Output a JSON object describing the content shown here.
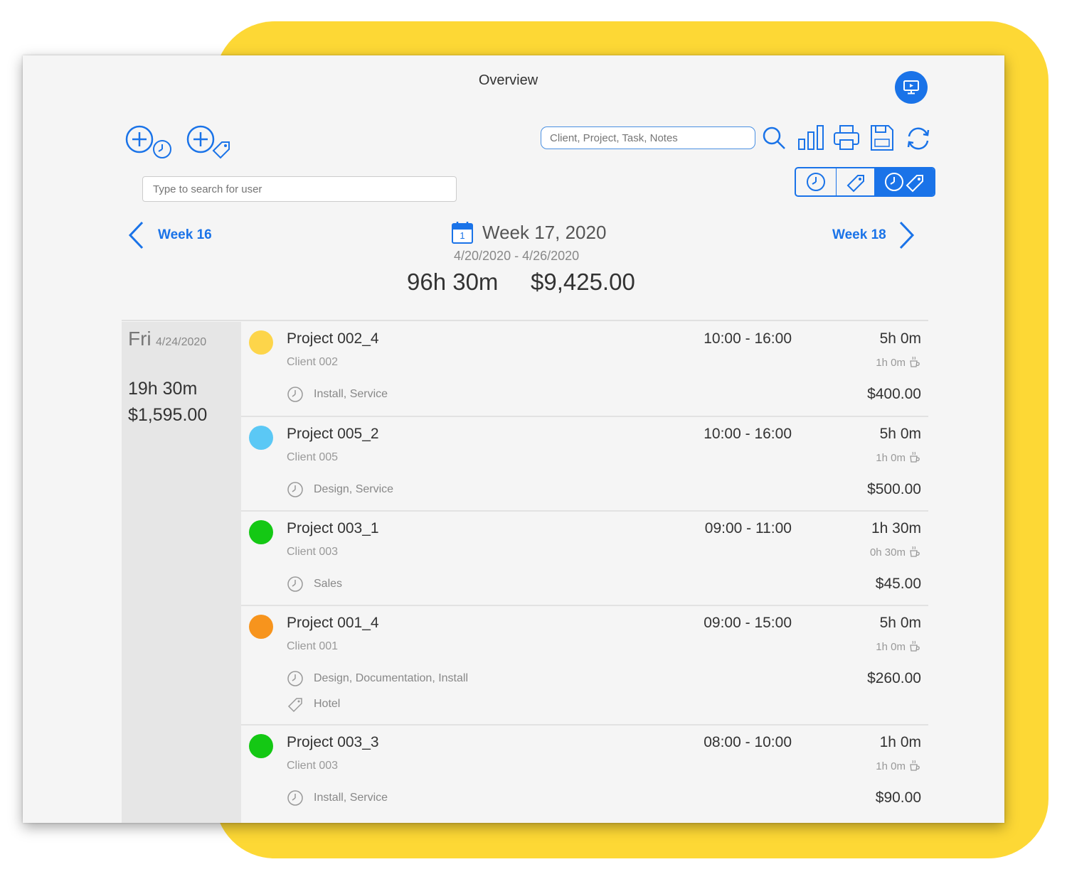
{
  "app": {
    "title": "Overview"
  },
  "toolbar": {
    "search_placeholder": "Client, Project, Task, Notes",
    "user_search_placeholder": "Type to search for user"
  },
  "week_nav": {
    "prev_label": "Week 16",
    "next_label": "Week 18",
    "current_title": "Week 17, 2020",
    "calendar_day": "1",
    "date_range": "4/20/2020 - 4/26/2020",
    "total_hours": "96h 30m",
    "total_amount": "$9,425.00"
  },
  "day": {
    "name": "Fri",
    "date": "4/24/2020",
    "hours": "19h 30m",
    "amount": "$1,595.00"
  },
  "entries": [
    {
      "project": "Project 002_4",
      "client": "Client 002",
      "time": "10:00 - 16:00",
      "duration": "5h 0m",
      "break": "1h 0m",
      "tasks": "Install, Service",
      "expense": "",
      "amount": "$400.00",
      "color": "#FDD54A"
    },
    {
      "project": "Project 005_2",
      "client": "Client 005",
      "time": "10:00 - 16:00",
      "duration": "5h 0m",
      "break": "1h 0m",
      "tasks": "Design, Service",
      "expense": "",
      "amount": "$500.00",
      "color": "#5BC8F5"
    },
    {
      "project": "Project 003_1",
      "client": "Client 003",
      "time": "09:00 - 11:00",
      "duration": "1h 30m",
      "break": "0h 30m",
      "tasks": "Sales",
      "expense": "",
      "amount": "$45.00",
      "color": "#14C814"
    },
    {
      "project": "Project 001_4",
      "client": "Client 001",
      "time": "09:00 - 15:00",
      "duration": "5h 0m",
      "break": "1h 0m",
      "tasks": "Design, Documentation, Install",
      "expense": "Hotel",
      "amount": "$260.00",
      "color": "#F7941D"
    },
    {
      "project": "Project 003_3",
      "client": "Client 003",
      "time": "08:00 - 10:00",
      "duration": "1h 0m",
      "break": "1h 0m",
      "tasks": "Install, Service",
      "expense": "",
      "amount": "$90.00",
      "color": "#14C814"
    }
  ],
  "colors": {
    "accent": "#1a73e8",
    "highlight": "#FDD835"
  },
  "icons": {
    "add_time_entry": "add-time-icon",
    "add_expense": "add-expense-icon",
    "search": "search-icon",
    "chart": "bar-chart-icon",
    "print": "print-icon",
    "export": "save-csv-icon",
    "sync": "sync-icon",
    "profile": "monitor-icon"
  }
}
